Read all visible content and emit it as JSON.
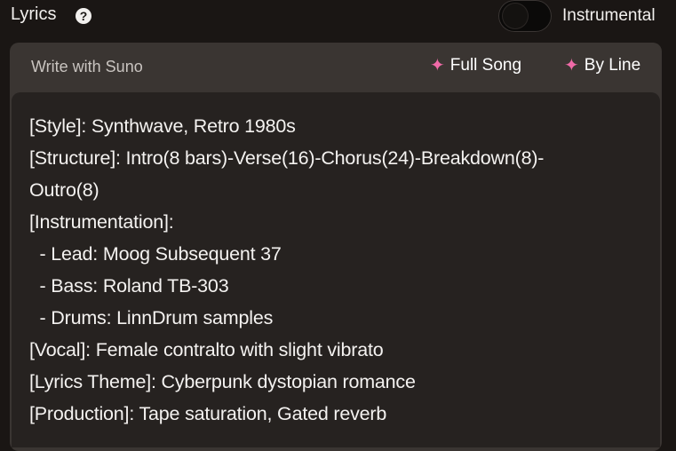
{
  "header": {
    "title": "Lyrics",
    "help_icon": "help-icon",
    "toggle_label": "Instrumental",
    "toggle_on": false
  },
  "card": {
    "write_label": "Write with Suno",
    "actions": [
      {
        "label": "Full Song",
        "icon": "sparkle-icon"
      },
      {
        "label": "By Line",
        "icon": "sparkle-icon"
      }
    ],
    "accent_color": "#f06aa8"
  },
  "editor": {
    "lines": [
      "[Style]: Synthwave, Retro 1980s",
      "[Structure]: Intro(8 bars)-Verse(16)-Chorus(24)-Breakdown(8)-",
      "Outro(8)",
      "[Instrumentation]:",
      "  - Lead: Moog Subsequent 37",
      "  - Bass: Roland TB-303",
      "  - Drums: LinnDrum samples",
      "[Vocal]: Female contralto with slight vibrato",
      "[Lyrics Theme]: Cyberpunk dystopian romance",
      "[Production]: Tape saturation, Gated reverb"
    ]
  }
}
